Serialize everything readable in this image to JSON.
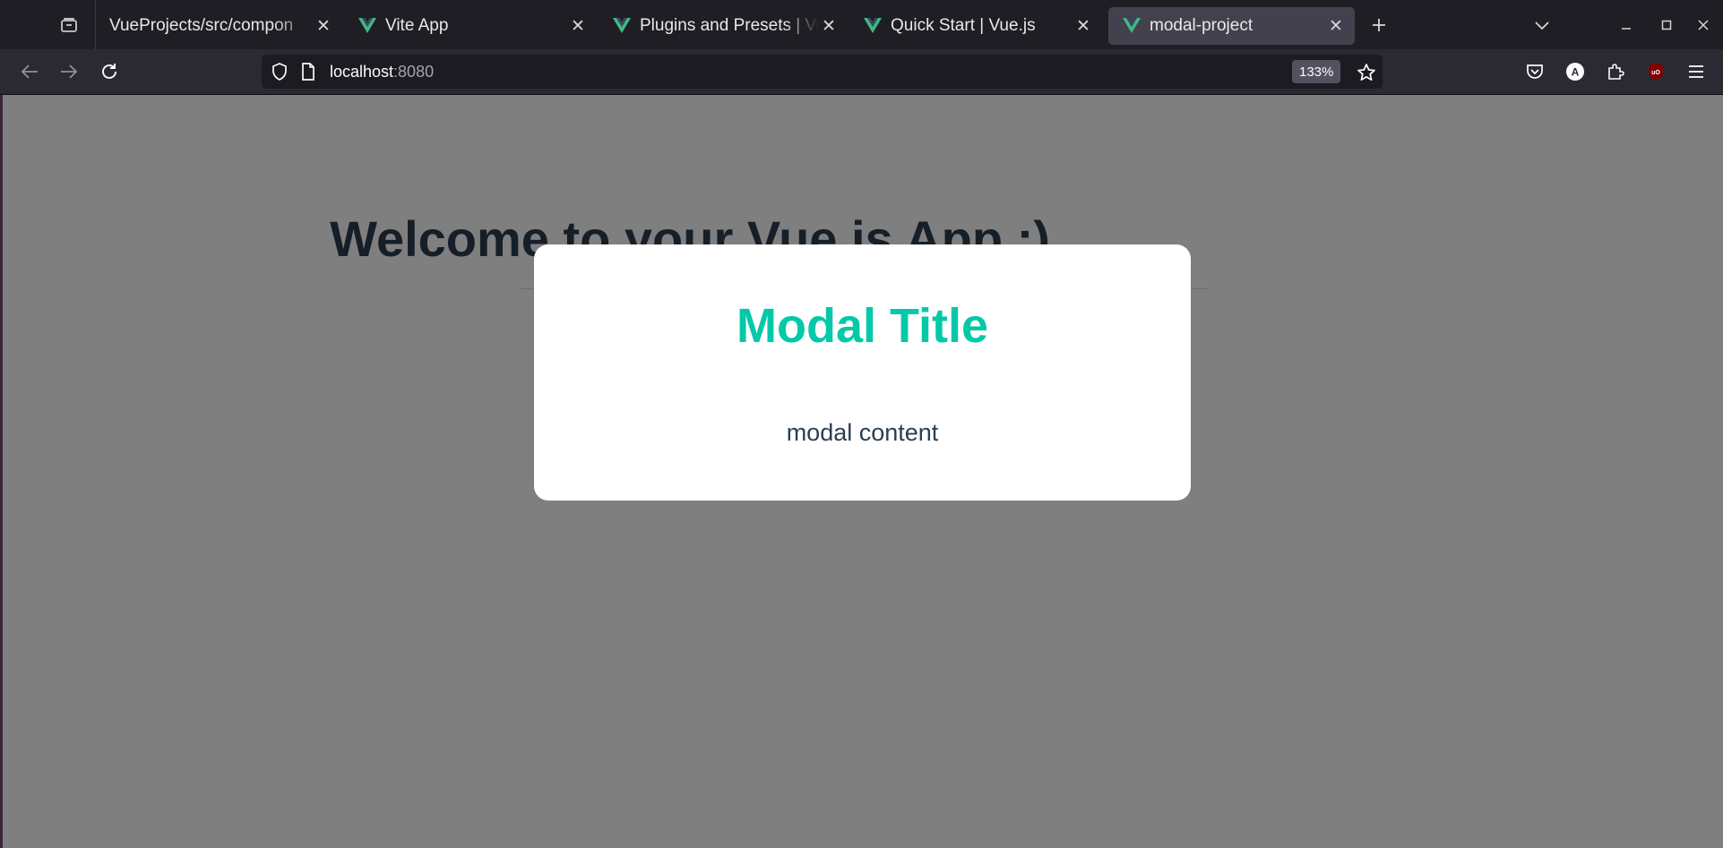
{
  "browser": {
    "tabs": [
      {
        "label": "VueProjects/src/compon",
        "favicon": "none",
        "active": false
      },
      {
        "label": "Vite App",
        "favicon": "vue-logo",
        "active": false
      },
      {
        "label": "Plugins and Presets | Vue",
        "favicon": "vue-logo",
        "active": false
      },
      {
        "label": "Quick Start | Vue.js",
        "favicon": "vue-logo",
        "active": false
      },
      {
        "label": "modal-project",
        "favicon": "vue-logo",
        "active": true
      }
    ],
    "url_host": "localhost",
    "url_port": ":8080",
    "zoom": "133%"
  },
  "page": {
    "heading": "Welcome to your Vue.js App :)"
  },
  "modal": {
    "title": "Modal Title",
    "content": "modal content"
  },
  "colors": {
    "modal_title": "#03c9a9",
    "body_text": "#2c3e50",
    "backdrop": "rgba(0,0,0,0.5)"
  }
}
